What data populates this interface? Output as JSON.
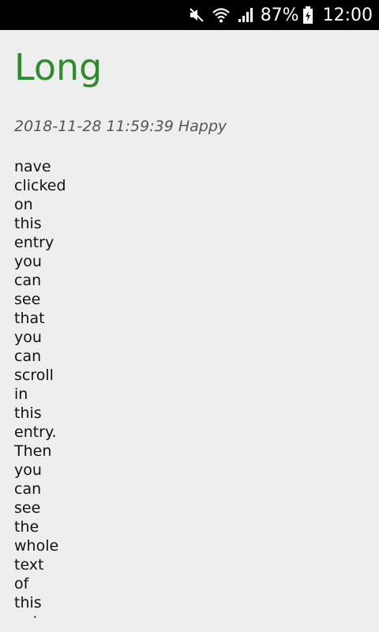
{
  "status_bar": {
    "battery_percent": "87%",
    "time": "12:00",
    "icons": [
      "mute-icon",
      "wifi-icon",
      "signal-icon",
      "battery-charging-icon"
    ]
  },
  "entry": {
    "title": "Long",
    "meta": "2018-11-28 11:59:39 Happy",
    "body_words": [
      "nave",
      "clicked",
      "on",
      "this",
      "entry",
      "you",
      "can",
      "see",
      "that",
      "you",
      "can",
      "scroll",
      "in",
      "this",
      "entry.",
      "Then",
      "you",
      "can",
      "see",
      "the",
      "whole",
      "text",
      "of",
      "this",
      "entry"
    ]
  },
  "colors": {
    "title": "#2e8b2e",
    "background": "#eeeeee"
  }
}
